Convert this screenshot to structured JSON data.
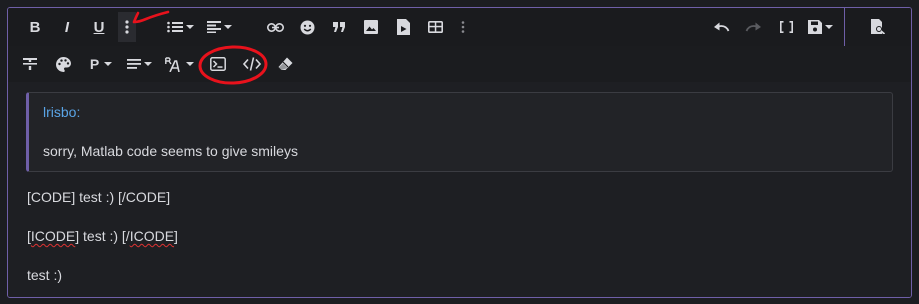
{
  "toolbar_row1": {
    "bold_label": "B",
    "italic_label": "I",
    "underline_label": "U",
    "icons": [
      "more-text-icon",
      "list-icon",
      "align-icon",
      "link-icon",
      "smiley-icon",
      "quote-icon",
      "image-icon",
      "media-icon",
      "table-icon",
      "more-insert-icon",
      "undo-icon",
      "redo-icon",
      "toggle-bbcode-icon",
      "drafts-icon",
      "preview-icon"
    ]
  },
  "toolbar_row2": {
    "paragraph_label": "P",
    "icons": [
      "strikethrough-icon",
      "color-palette-icon",
      "paragraph-format-icon",
      "line-spacing-icon",
      "font-style-icon",
      "code-block-icon",
      "inline-code-icon",
      "eraser-icon"
    ]
  },
  "quote": {
    "author": "lrisbo:",
    "text": "sorry, Matlab code seems to give smileys"
  },
  "paragraphs": {
    "p1": "[CODE] test :) [/CODE]",
    "p2_open": "[",
    "p2_word": "ICODE",
    "p2_mid": "] test :) [/",
    "p2_word2": "ICODE",
    "p2_close": "]",
    "p3": "test :)"
  },
  "colors": {
    "accent": "#6f5fa8",
    "author": "#5aa4e6",
    "annotation": "#e8121c"
  }
}
